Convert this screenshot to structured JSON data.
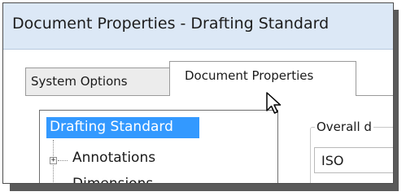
{
  "window": {
    "title": "Document Properties - Drafting Standard"
  },
  "tabs": [
    {
      "label": "System Options",
      "active": false
    },
    {
      "label": "Document Properties",
      "active": true
    }
  ],
  "tree": {
    "items": [
      {
        "label": "Drafting Standard",
        "selected": true
      },
      {
        "label": "Annotations",
        "expandable": true
      },
      {
        "label": "Dimensions",
        "expandable": true
      }
    ]
  },
  "overall": {
    "label": "Overall d",
    "value": "ISO"
  },
  "icons": {
    "expander": "plus-expander-icon",
    "cursor": "arrow-cursor-icon"
  },
  "colors": {
    "titlebar": "#dce8f6",
    "selection": "#3399ff"
  }
}
